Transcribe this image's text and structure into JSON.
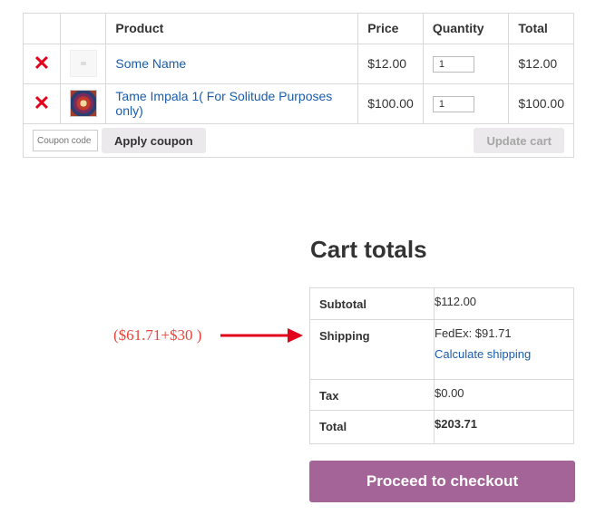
{
  "cart": {
    "headers": {
      "remove": "",
      "thumb": "",
      "product": "Product",
      "price": "Price",
      "quantity": "Quantity",
      "total": "Total"
    },
    "items": [
      {
        "name": "Some Name",
        "price": "$12.00",
        "quantity": "1",
        "total": "$12.00"
      },
      {
        "name": "Tame Impala 1( For Solitude Purposes only)",
        "price": "$100.00",
        "quantity": "1",
        "total": "$100.00"
      }
    ],
    "coupon_placeholder": "Coupon code",
    "apply_coupon_label": "Apply coupon",
    "update_cart_label": "Update cart"
  },
  "totals": {
    "title": "Cart totals",
    "subtotal_label": "Subtotal",
    "subtotal_value": "$112.00",
    "shipping_label": "Shipping",
    "shipping_value": "FedEx: $91.71",
    "calculate_shipping": "Calculate shipping",
    "tax_label": "Tax",
    "tax_value": "$0.00",
    "total_label": "Total",
    "total_value": "$203.71",
    "checkout_label": "Proceed to checkout"
  },
  "annotation": {
    "text": "($61.71+$30 )",
    "color": "#e8453c"
  },
  "colors": {
    "accent": "#a46497",
    "link": "#1a5dab",
    "remove": "#e2001a"
  }
}
